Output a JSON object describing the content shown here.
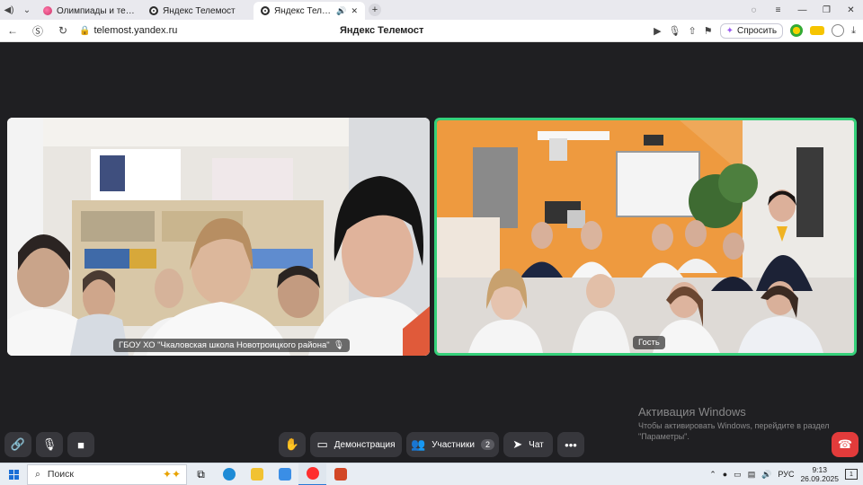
{
  "browser": {
    "tabs": [
      {
        "label": "Олимпиады и тестирования",
        "favicon": "olympiad-icon"
      },
      {
        "label": "Яндекс Телемост",
        "favicon": "telemost-icon"
      },
      {
        "label": "Яндекс Телемост",
        "favicon": "telemost-icon",
        "active": true
      }
    ],
    "url": "telemost.yandex.ru",
    "page_title": "Яндекс Телемост",
    "ask_button": "Спросить"
  },
  "meeting": {
    "participants": [
      {
        "name": "ГБОУ ХО \"Чкаловская школа Новотроицкого района\""
      },
      {
        "name": "Гость",
        "speaking": true
      }
    ],
    "controls": {
      "demo": "Демонстрация",
      "participants": "Участники",
      "participants_count": "2",
      "chat": "Чат"
    },
    "speaking_color": "#35d07a",
    "hangup_color": "#e23b3b"
  },
  "watermark": {
    "title": "Активация Windows",
    "text": "Чтобы активировать Windows, перейдите в раздел \"Параметры\"."
  },
  "taskbar": {
    "search_placeholder": "Поиск",
    "lang": "РУС",
    "time": "9:13",
    "date": "26.09.2025",
    "notifications": "1"
  }
}
